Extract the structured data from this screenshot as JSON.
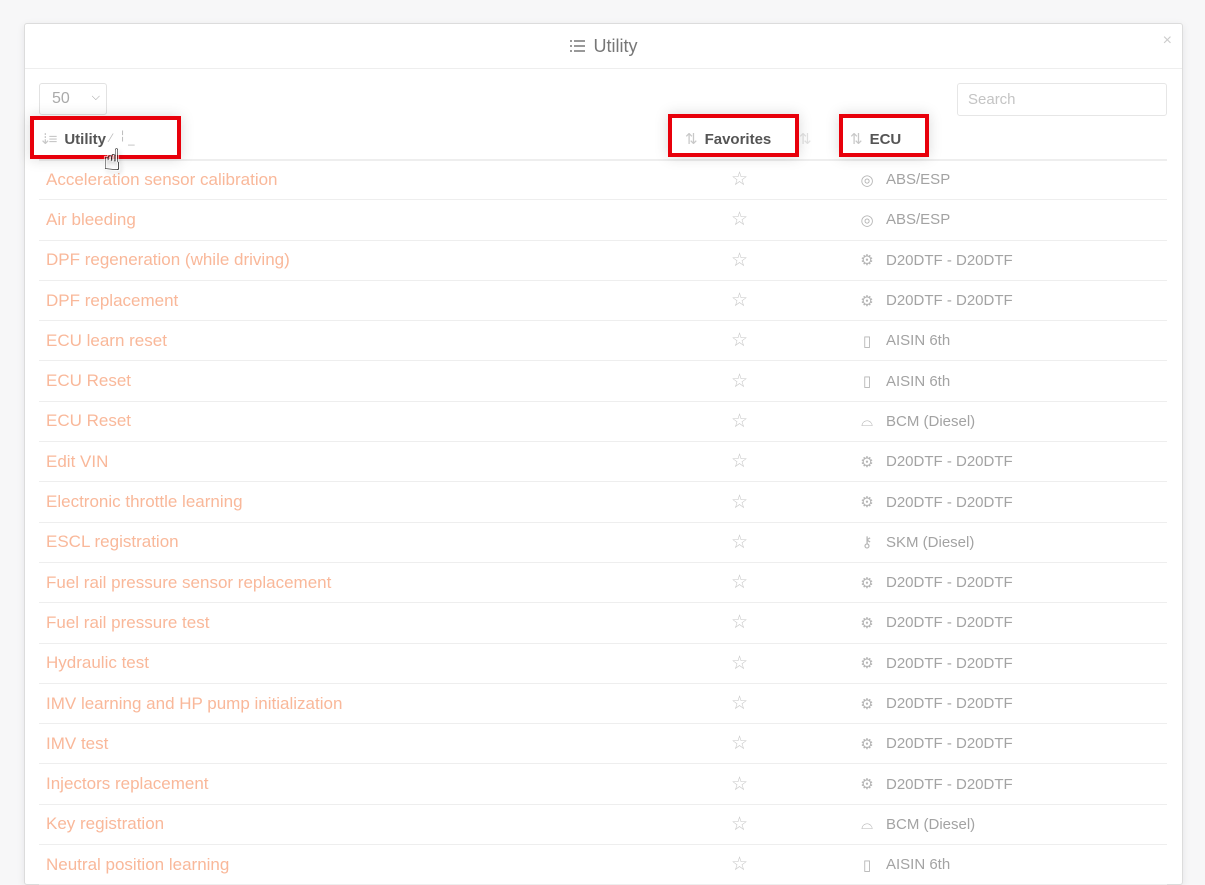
{
  "modal": {
    "title": "Utility",
    "title_icon": "list-icon",
    "close_label": "×"
  },
  "controls": {
    "page_size": "50",
    "search_placeholder": "Search",
    "search_value": ""
  },
  "table": {
    "columns": [
      {
        "label": "Utility",
        "sort": "sorted-ascending"
      },
      {
        "label": "Favorites",
        "sort": "unsorted"
      },
      {
        "label": "ECU",
        "sort": "unsorted"
      }
    ],
    "rows": [
      {
        "name": "Acceleration sensor calibration",
        "favorite": false,
        "ecu": "ABS/ESP",
        "ecu_icon": "brake-disc-icon"
      },
      {
        "name": "Air bleeding",
        "favorite": false,
        "ecu": "ABS/ESP",
        "ecu_icon": "brake-disc-icon"
      },
      {
        "name": "DPF regeneration (while driving)",
        "favorite": false,
        "ecu": "D20DTF - D20DTF",
        "ecu_icon": "engine-icon"
      },
      {
        "name": "DPF replacement",
        "favorite": false,
        "ecu": "D20DTF - D20DTF",
        "ecu_icon": "engine-icon"
      },
      {
        "name": "ECU learn reset",
        "favorite": false,
        "ecu": "AISIN 6th",
        "ecu_icon": "gearbox-icon"
      },
      {
        "name": "ECU Reset",
        "favorite": false,
        "ecu": "AISIN 6th",
        "ecu_icon": "gearbox-icon"
      },
      {
        "name": "ECU Reset",
        "favorite": false,
        "ecu": "BCM (Diesel)",
        "ecu_icon": "car-body-icon"
      },
      {
        "name": "Edit VIN",
        "favorite": false,
        "ecu": "D20DTF - D20DTF",
        "ecu_icon": "engine-icon"
      },
      {
        "name": "Electronic throttle learning",
        "favorite": false,
        "ecu": "D20DTF - D20DTF",
        "ecu_icon": "engine-icon"
      },
      {
        "name": "ESCL registration",
        "favorite": false,
        "ecu": "SKM (Diesel)",
        "ecu_icon": "key-fob-icon"
      },
      {
        "name": "Fuel rail pressure sensor replacement",
        "favorite": false,
        "ecu": "D20DTF - D20DTF",
        "ecu_icon": "engine-icon"
      },
      {
        "name": "Fuel rail pressure test",
        "favorite": false,
        "ecu": "D20DTF - D20DTF",
        "ecu_icon": "engine-icon"
      },
      {
        "name": "Hydraulic test",
        "favorite": false,
        "ecu": "D20DTF - D20DTF",
        "ecu_icon": "engine-icon"
      },
      {
        "name": "IMV learning and HP pump initialization",
        "favorite": false,
        "ecu": "D20DTF - D20DTF",
        "ecu_icon": "engine-icon"
      },
      {
        "name": "IMV test",
        "favorite": false,
        "ecu": "D20DTF - D20DTF",
        "ecu_icon": "engine-icon"
      },
      {
        "name": "Injectors replacement",
        "favorite": false,
        "ecu": "D20DTF - D20DTF",
        "ecu_icon": "engine-icon"
      },
      {
        "name": "Key registration",
        "favorite": false,
        "ecu": "BCM (Diesel)",
        "ecu_icon": "car-body-icon"
      },
      {
        "name": "Neutral position learning",
        "favorite": false,
        "ecu": "AISIN 6th",
        "ecu_icon": "gearbox-icon"
      }
    ]
  },
  "colors": {
    "link": "#f9b89a",
    "highlight": "#e8000b"
  }
}
